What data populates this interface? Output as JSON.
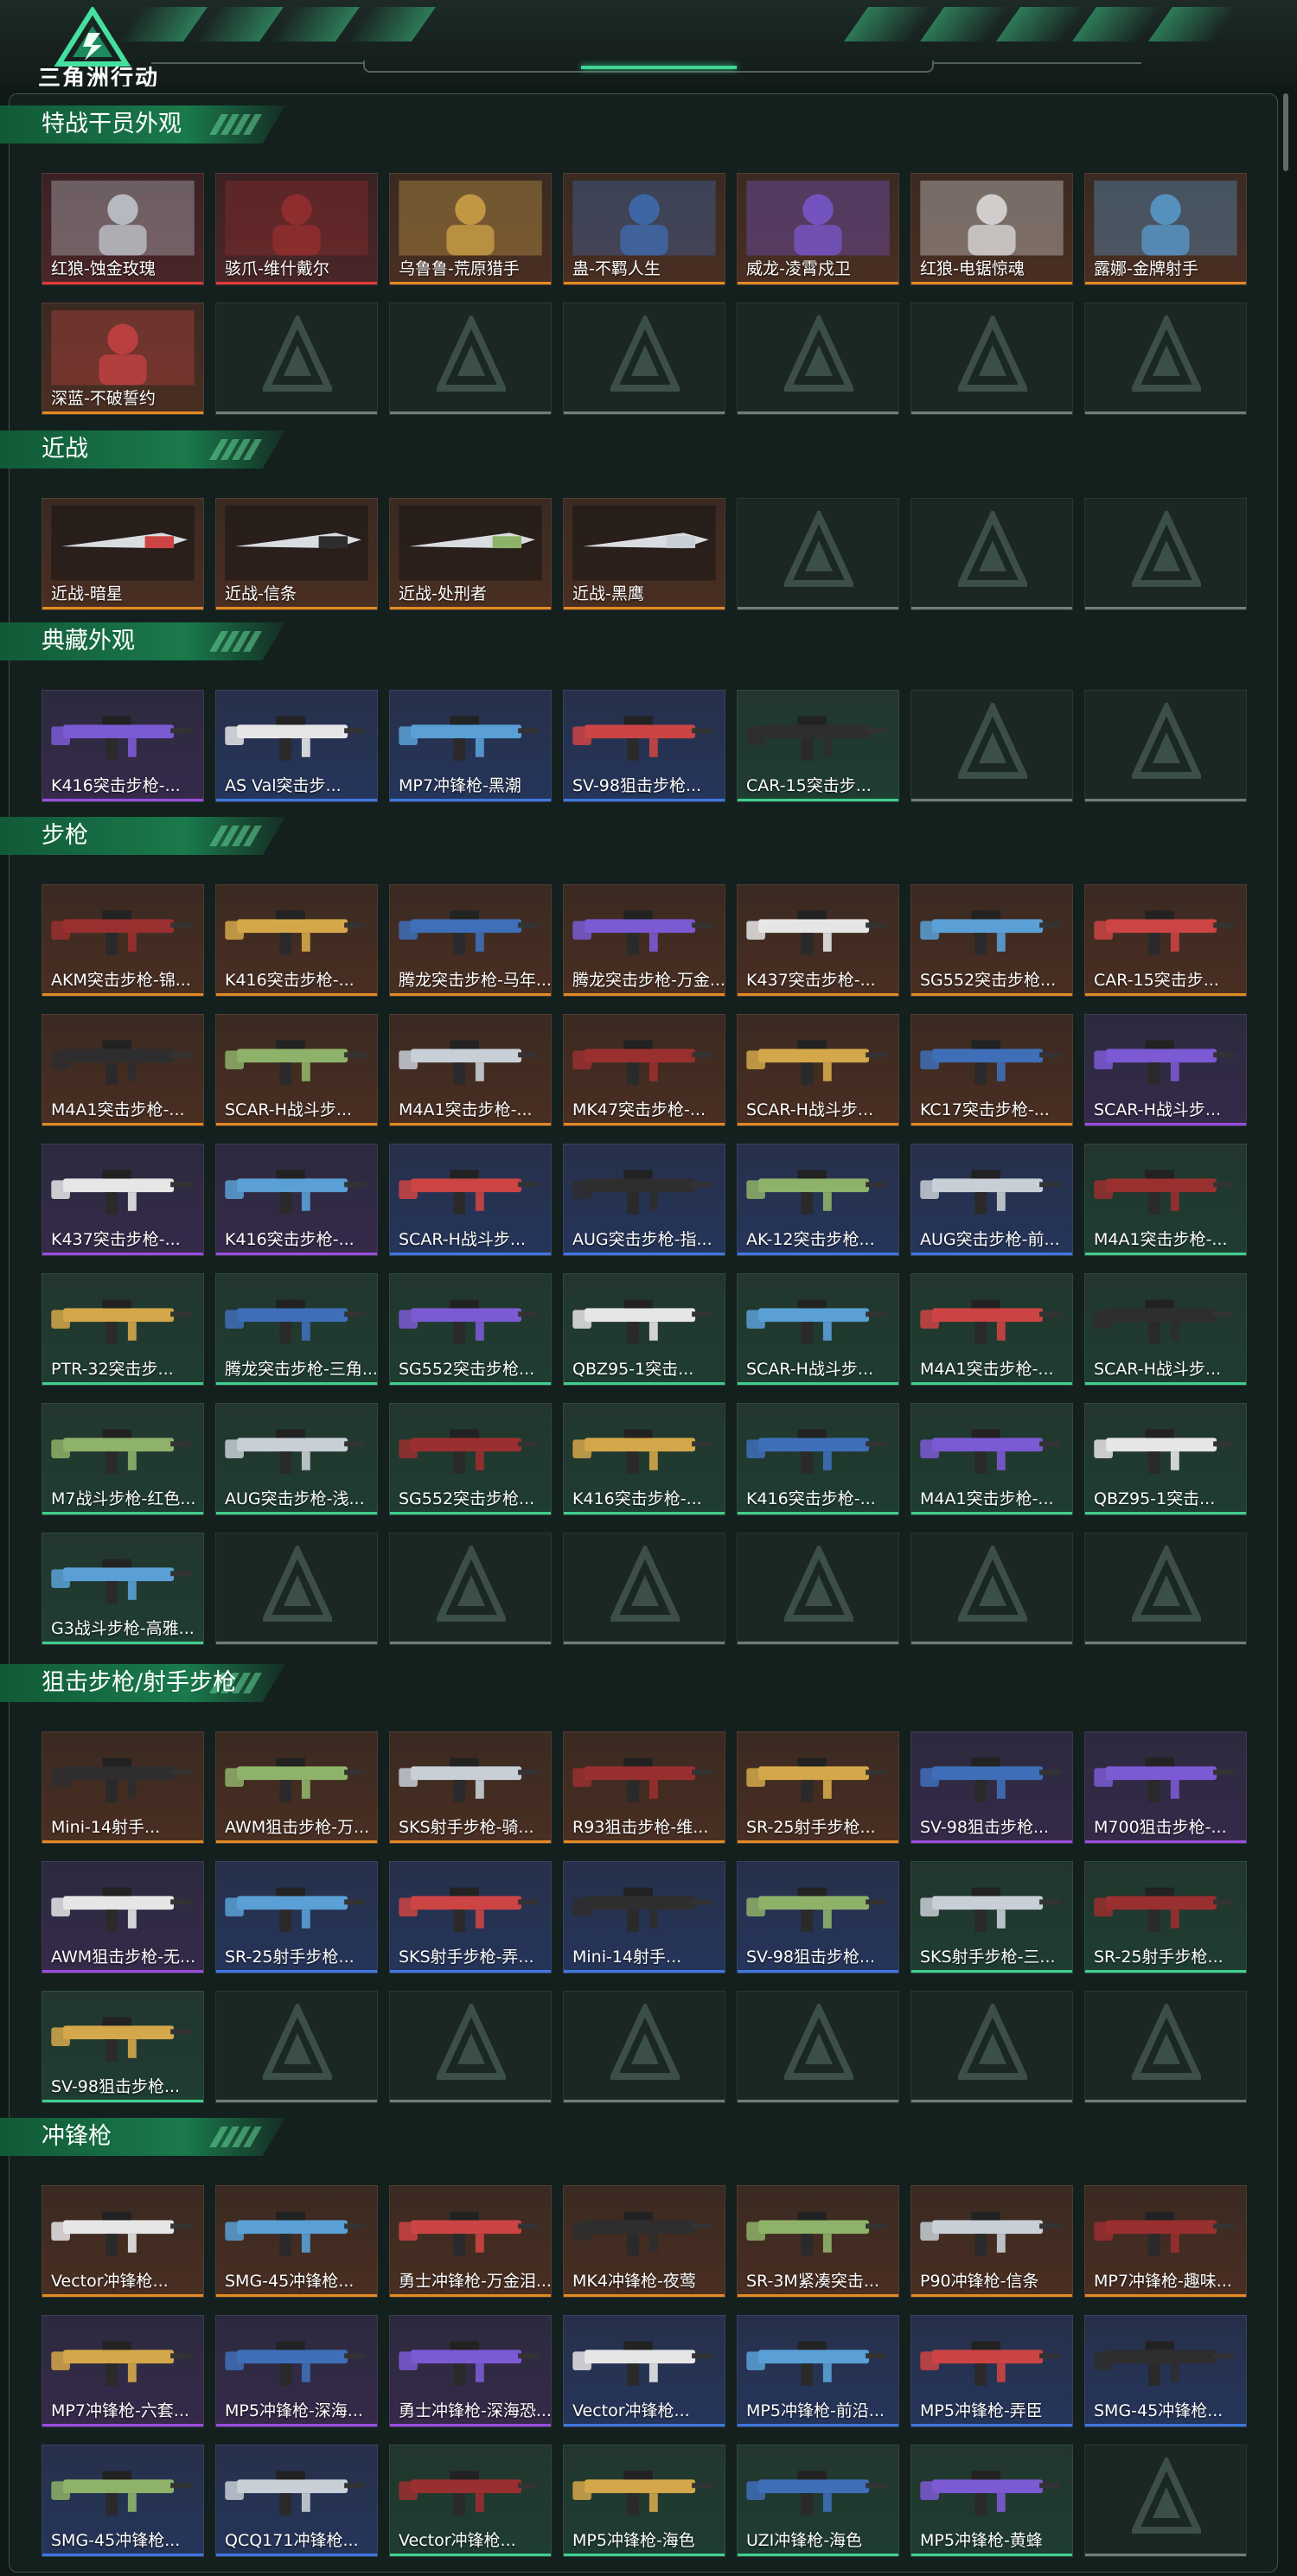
{
  "header": {
    "brand": "三角洲行动"
  },
  "sections": [
    {
      "title": "特战干员外观",
      "items": [
        {
          "label": "红狼-蚀金玫瑰",
          "rarity": "red"
        },
        {
          "label": "骇爪-维什戴尔",
          "rarity": "red"
        },
        {
          "label": "乌鲁鲁-荒原猎手",
          "rarity": "orange"
        },
        {
          "label": "蛊-不羁人生",
          "rarity": "orange"
        },
        {
          "label": "威龙-凌霄戍卫",
          "rarity": "orange"
        },
        {
          "label": "红狼-电锯惊魂",
          "rarity": "orange"
        },
        {
          "label": "露娜-金牌射手",
          "rarity": "orange"
        },
        {
          "label": "深蓝-不破誓约",
          "rarity": "orange"
        },
        {
          "label": "",
          "rarity": "empty"
        },
        {
          "label": "",
          "rarity": "empty"
        },
        {
          "label": "",
          "rarity": "empty"
        },
        {
          "label": "",
          "rarity": "empty"
        },
        {
          "label": "",
          "rarity": "empty"
        },
        {
          "label": "",
          "rarity": "empty"
        }
      ]
    },
    {
      "title": "近战",
      "items": [
        {
          "label": "近战-暗星",
          "rarity": "orange"
        },
        {
          "label": "近战-信条",
          "rarity": "orange"
        },
        {
          "label": "近战-处刑者",
          "rarity": "orange"
        },
        {
          "label": "近战-黑鹰",
          "rarity": "orange"
        },
        {
          "label": "",
          "rarity": "empty"
        },
        {
          "label": "",
          "rarity": "empty"
        },
        {
          "label": "",
          "rarity": "empty"
        }
      ]
    },
    {
      "title": "典藏外观",
      "items": [
        {
          "label": "K416突击步枪-...",
          "rarity": "purple"
        },
        {
          "label": "AS Val突击步...",
          "rarity": "blue"
        },
        {
          "label": "MP7冲锋枪-黑潮",
          "rarity": "blue"
        },
        {
          "label": "SV-98狙击步枪...",
          "rarity": "blue"
        },
        {
          "label": "CAR-15突击步...",
          "rarity": "green"
        },
        {
          "label": "",
          "rarity": "empty"
        },
        {
          "label": "",
          "rarity": "empty"
        }
      ]
    },
    {
      "title": "步枪",
      "items": [
        {
          "label": "AKM突击步枪-锦...",
          "rarity": "orange"
        },
        {
          "label": "K416突击步枪-...",
          "rarity": "orange"
        },
        {
          "label": "腾龙突击步枪-马年...",
          "rarity": "orange"
        },
        {
          "label": "腾龙突击步枪-万金...",
          "rarity": "orange"
        },
        {
          "label": "K437突击步枪-...",
          "rarity": "orange"
        },
        {
          "label": "SG552突击步枪...",
          "rarity": "orange"
        },
        {
          "label": "CAR-15突击步...",
          "rarity": "orange"
        },
        {
          "label": "M4A1突击步枪-...",
          "rarity": "orange"
        },
        {
          "label": "SCAR-H战斗步...",
          "rarity": "orange"
        },
        {
          "label": "M4A1突击步枪-...",
          "rarity": "orange"
        },
        {
          "label": "MK47突击步枪-...",
          "rarity": "orange"
        },
        {
          "label": "SCAR-H战斗步...",
          "rarity": "orange"
        },
        {
          "label": "KC17突击步枪-...",
          "rarity": "orange"
        },
        {
          "label": "SCAR-H战斗步...",
          "rarity": "purple"
        },
        {
          "label": "K437突击步枪-...",
          "rarity": "purple"
        },
        {
          "label": "K416突击步枪-...",
          "rarity": "purple"
        },
        {
          "label": "SCAR-H战斗步...",
          "rarity": "blue"
        },
        {
          "label": "AUG突击步枪-指...",
          "rarity": "blue"
        },
        {
          "label": "AK-12突击步枪...",
          "rarity": "blue"
        },
        {
          "label": "AUG突击步枪-前...",
          "rarity": "blue"
        },
        {
          "label": "M4A1突击步枪-...",
          "rarity": "green"
        },
        {
          "label": "PTR-32突击步...",
          "rarity": "green"
        },
        {
          "label": "腾龙突击步枪-三角...",
          "rarity": "green"
        },
        {
          "label": "SG552突击步枪...",
          "rarity": "green"
        },
        {
          "label": "QBZ95-1突击...",
          "rarity": "green"
        },
        {
          "label": "SCAR-H战斗步...",
          "rarity": "green"
        },
        {
          "label": "M4A1突击步枪-...",
          "rarity": "green"
        },
        {
          "label": "SCAR-H战斗步...",
          "rarity": "green"
        },
        {
          "label": "M7战斗步枪-红色...",
          "rarity": "green"
        },
        {
          "label": "AUG突击步枪-浅...",
          "rarity": "green"
        },
        {
          "label": "SG552突击步枪...",
          "rarity": "green"
        },
        {
          "label": "K416突击步枪-...",
          "rarity": "green"
        },
        {
          "label": "K416突击步枪-...",
          "rarity": "green"
        },
        {
          "label": "M4A1突击步枪-...",
          "rarity": "green"
        },
        {
          "label": "QBZ95-1突击...",
          "rarity": "green"
        },
        {
          "label": "G3战斗步枪-高雅...",
          "rarity": "green"
        },
        {
          "label": "",
          "rarity": "empty"
        },
        {
          "label": "",
          "rarity": "empty"
        },
        {
          "label": "",
          "rarity": "empty"
        },
        {
          "label": "",
          "rarity": "empty"
        },
        {
          "label": "",
          "rarity": "empty"
        },
        {
          "label": "",
          "rarity": "empty"
        }
      ]
    },
    {
      "title": "狙击步枪/射手步枪",
      "items": [
        {
          "label": "Mini-14射手...",
          "rarity": "orange"
        },
        {
          "label": "AWM狙击步枪-万...",
          "rarity": "orange"
        },
        {
          "label": "SKS射手步枪-骑...",
          "rarity": "orange"
        },
        {
          "label": "R93狙击步枪-维...",
          "rarity": "orange"
        },
        {
          "label": "SR-25射手步枪...",
          "rarity": "orange"
        },
        {
          "label": "SV-98狙击步枪...",
          "rarity": "purple"
        },
        {
          "label": "M700狙击步枪-...",
          "rarity": "purple"
        },
        {
          "label": "AWM狙击步枪-无...",
          "rarity": "purple"
        },
        {
          "label": "SR-25射手步枪...",
          "rarity": "blue"
        },
        {
          "label": "SKS射手步枪-弄...",
          "rarity": "blue"
        },
        {
          "label": "Mini-14射手...",
          "rarity": "blue"
        },
        {
          "label": "SV-98狙击步枪...",
          "rarity": "blue"
        },
        {
          "label": "SKS射手步枪-三...",
          "rarity": "green"
        },
        {
          "label": "SR-25射手步枪...",
          "rarity": "green"
        },
        {
          "label": "SV-98狙击步枪...",
          "rarity": "green"
        },
        {
          "label": "",
          "rarity": "empty"
        },
        {
          "label": "",
          "rarity": "empty"
        },
        {
          "label": "",
          "rarity": "empty"
        },
        {
          "label": "",
          "rarity": "empty"
        },
        {
          "label": "",
          "rarity": "empty"
        },
        {
          "label": "",
          "rarity": "empty"
        }
      ]
    },
    {
      "title": "冲锋枪",
      "items": [
        {
          "label": "Vector冲锋枪...",
          "rarity": "orange"
        },
        {
          "label": "SMG-45冲锋枪...",
          "rarity": "orange"
        },
        {
          "label": "勇士冲锋枪-万金泪...",
          "rarity": "orange"
        },
        {
          "label": "MK4冲锋枪-夜莺",
          "rarity": "orange"
        },
        {
          "label": "SR-3M紧凑突击...",
          "rarity": "orange"
        },
        {
          "label": "P90冲锋枪-信条",
          "rarity": "orange"
        },
        {
          "label": "MP7冲锋枪-趣味...",
          "rarity": "orange"
        },
        {
          "label": "MP7冲锋枪-六套...",
          "rarity": "purple"
        },
        {
          "label": "MP5冲锋枪-深海...",
          "rarity": "purple"
        },
        {
          "label": "勇士冲锋枪-深海恐...",
          "rarity": "purple"
        },
        {
          "label": "Vector冲锋枪...",
          "rarity": "blue"
        },
        {
          "label": "MP5冲锋枪-前沿...",
          "rarity": "blue"
        },
        {
          "label": "MP5冲锋枪-弄臣",
          "rarity": "blue"
        },
        {
          "label": "SMG-45冲锋枪...",
          "rarity": "blue"
        },
        {
          "label": "SMG-45冲锋枪...",
          "rarity": "blue"
        },
        {
          "label": "QCQ171冲锋枪...",
          "rarity": "blue"
        },
        {
          "label": "Vector冲锋枪...",
          "rarity": "green"
        },
        {
          "label": "MP5冲锋枪-海色",
          "rarity": "green"
        },
        {
          "label": "UZI冲锋枪-海色",
          "rarity": "green"
        },
        {
          "label": "MP5冲锋枪-黄蜂",
          "rarity": "green"
        },
        {
          "label": "",
          "rarity": "empty"
        }
      ]
    }
  ]
}
